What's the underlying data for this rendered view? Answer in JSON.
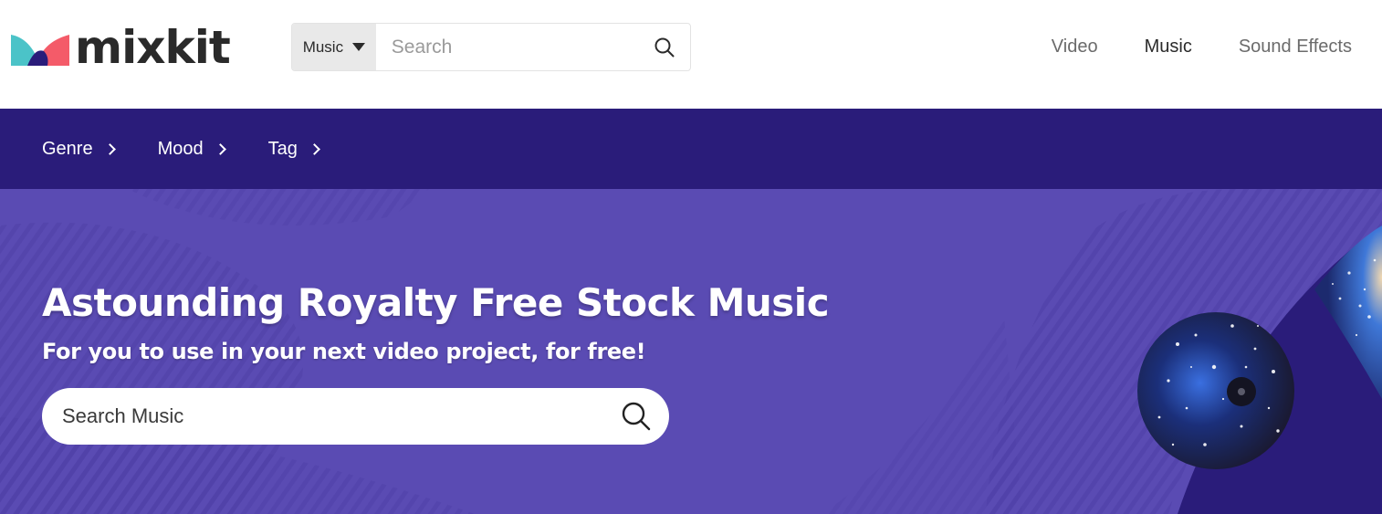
{
  "brand": {
    "name": "mixkit",
    "colors": {
      "teal": "#4bc3c8",
      "coral": "#f45b69",
      "navy": "#2a1c7a",
      "dark": "#2a2a2a"
    }
  },
  "header": {
    "search": {
      "type_label": "Music",
      "placeholder": "Search",
      "icon": "search-icon"
    },
    "nav": [
      {
        "label": "Video",
        "active": false
      },
      {
        "label": "Music",
        "active": true
      },
      {
        "label": "Sound Effects",
        "active": false
      }
    ]
  },
  "subnav": {
    "items": [
      {
        "label": "Genre",
        "icon": "chevron-right-icon"
      },
      {
        "label": "Mood",
        "icon": "chevron-right-icon"
      },
      {
        "label": "Tag",
        "icon": "chevron-right-icon"
      }
    ]
  },
  "hero": {
    "title": "Astounding Royalty Free Stock Music",
    "subtitle": "For you to use in your next video project, for free!",
    "search_placeholder": "Search Music",
    "search_icon": "search-icon",
    "colors": {
      "background": "#5a4bb3",
      "accent_dark": "#2a1c7a"
    }
  }
}
